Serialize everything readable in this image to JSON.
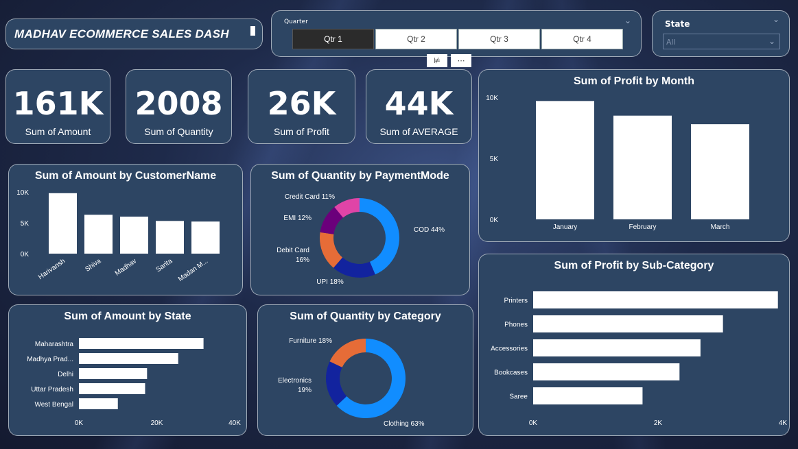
{
  "title": "MADHAV ECOMMERCE SALES DASH",
  "quarter_slicer": {
    "label": "Quarter",
    "options": [
      "Qtr 1",
      "Qtr 2",
      "Qtr 3",
      "Qtr 4"
    ],
    "selected": "Qtr 1"
  },
  "state_slicer": {
    "label": "State",
    "value": "All"
  },
  "kpis": [
    {
      "value": "161K",
      "label": "Sum of Amount"
    },
    {
      "value": "2008",
      "label": "Sum of Quantity"
    },
    {
      "value": "26K",
      "label": "Sum of Profit"
    },
    {
      "value": "44K",
      "label": "Sum of AVERAGE"
    }
  ],
  "colors": {
    "card": "#2d4563",
    "bar": "#ffffff",
    "blue": "#118dff",
    "navy": "#12239e",
    "orange": "#e66c37",
    "purple": "#6b007b",
    "pink": "#e044a7"
  },
  "chart_data": [
    {
      "id": "profit_by_month",
      "type": "bar",
      "title": "Sum of Profit by Month",
      "categories": [
        "January",
        "February",
        "March"
      ],
      "values": [
        9700,
        8500,
        7800
      ],
      "yticks": [
        "0K",
        "5K",
        "10K"
      ],
      "ylim": [
        0,
        10000
      ]
    },
    {
      "id": "amount_by_customer",
      "type": "bar",
      "title": "Sum of Amount by CustomerName",
      "categories": [
        "Harivansh",
        "Shiva",
        "Madhav",
        "Sarita",
        "Madan M..."
      ],
      "values": [
        9800,
        6300,
        6000,
        5300,
        5200
      ],
      "yticks": [
        "0K",
        "5K",
        "10K"
      ],
      "ylim": [
        0,
        10000
      ]
    },
    {
      "id": "quantity_by_paymentmode",
      "type": "pie",
      "title": "Sum of Quantity by PaymentMode",
      "categories": [
        "COD",
        "UPI",
        "Debit Card",
        "EMI",
        "Credit Card"
      ],
      "values": [
        44,
        18,
        16,
        12,
        11
      ],
      "labels": [
        "COD 44%",
        "UPI 18%",
        "Debit Card 16%",
        "EMI 12%",
        "Credit Card 11%"
      ]
    },
    {
      "id": "amount_by_state",
      "type": "bar",
      "title": "Sum of Amount by State",
      "categories": [
        "Maharashtra",
        "Madhya Prad...",
        "Delhi",
        "Uttar Pradesh",
        "West Bengal"
      ],
      "values": [
        32000,
        25500,
        17500,
        17000,
        10000
      ],
      "xticks": [
        "0K",
        "20K",
        "40K"
      ],
      "xlim": [
        0,
        40000
      ]
    },
    {
      "id": "quantity_by_category",
      "type": "pie",
      "title": "Sum of Quantity by Category",
      "categories": [
        "Clothing",
        "Electronics",
        "Furniture"
      ],
      "values": [
        63,
        19,
        18
      ],
      "labels": [
        "Clothing 63%",
        "Electronics 19%",
        "Furniture 18%"
      ]
    },
    {
      "id": "profit_by_subcategory",
      "type": "bar",
      "title": "Sum of Profit by Sub-Category",
      "categories": [
        "Printers",
        "Phones",
        "Accessories",
        "Bookcases",
        "Saree"
      ],
      "values": [
        4900,
        3800,
        3350,
        2930,
        2190
      ],
      "xticks": [
        "0K",
        "2K",
        "4K"
      ],
      "xlim": [
        0,
        5000
      ]
    }
  ]
}
